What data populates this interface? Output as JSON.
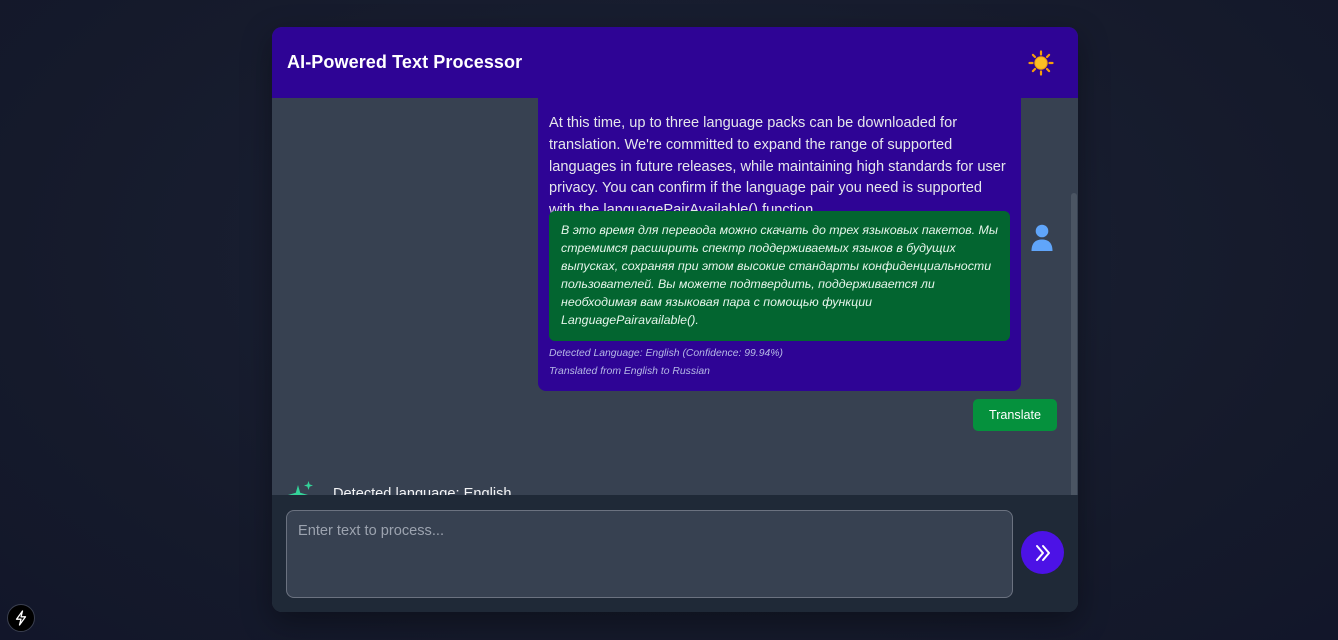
{
  "app": {
    "title": "AI-Powered Text Processor",
    "theme_icon": "sun-icon"
  },
  "chat": {
    "user_message": {
      "text": "At this time, up to three language packs can be downloaded for translation. We're committed to expand the range of supported languages in future releases, while maintaining high standards for user privacy. You can confirm if the language pair you need is supported with the languagePairAvailable() function.",
      "translation": "В это время для перевода можно скачать до трех языковых пакетов. Мы стремимся расширить спектр поддерживаемых языков в будущих выпусках, сохраняя при этом высокие стандарты конфиденциальности пользователей. Вы можете подтвердить, поддерживается ли необходимая вам языковая пара с помощью функции LanguagePairavailable().",
      "detected_language": "Detected Language: English (Confidence: 99.94%)",
      "translated_from": "Translated from English to Russian",
      "avatar_icon": "user-icon"
    },
    "translate_button": "Translate",
    "ai_message": {
      "icon": "sparkles-icon",
      "text": "Detected language: English"
    }
  },
  "composer": {
    "placeholder": "Enter text to process...",
    "value": "",
    "send_icon": "double-chevron-right-icon"
  },
  "colors": {
    "header": "#2e0495",
    "chat_bg": "#374151",
    "translation_bg": "#036530",
    "translate_button": "#05913d",
    "send_button": "#4c12e6",
    "sparkle": "#34d399",
    "avatar": "#60a5fa"
  }
}
